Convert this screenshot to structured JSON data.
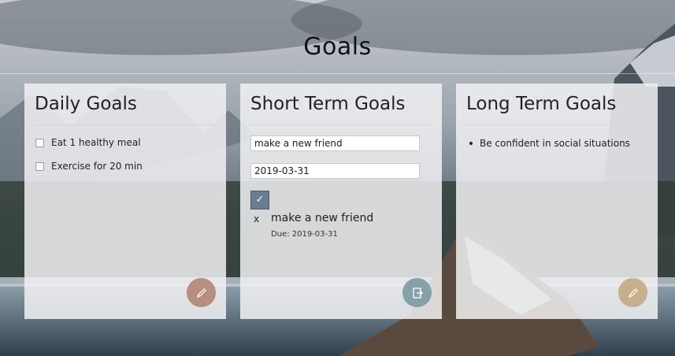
{
  "page_title": "Goals",
  "colors": {
    "card_background": "#f0f0f2",
    "daily_fab": "#b88f7e",
    "short_fab": "#85a2a8",
    "long_fab": "#c6b08c",
    "check_button": "#6b7d91"
  },
  "daily": {
    "title": "Daily Goals",
    "items": [
      {
        "label": "Eat 1 healthy meal",
        "checked": false
      },
      {
        "label": "Exercise for 20 min",
        "checked": false
      }
    ],
    "fab_icon": "pencil-icon"
  },
  "short": {
    "title": "Short Term Goals",
    "goal_input_value": "make a new friend",
    "date_input_value": "2019-03-31",
    "submit_icon": "✓",
    "goals": [
      {
        "remove": "x",
        "name": "make a new friend",
        "due": "Due: 2019-03-31"
      }
    ],
    "fab_icon": "export-icon"
  },
  "long": {
    "title": "Long Term Goals",
    "items": [
      "Be confident in social situations"
    ],
    "fab_icon": "pencil-icon"
  }
}
